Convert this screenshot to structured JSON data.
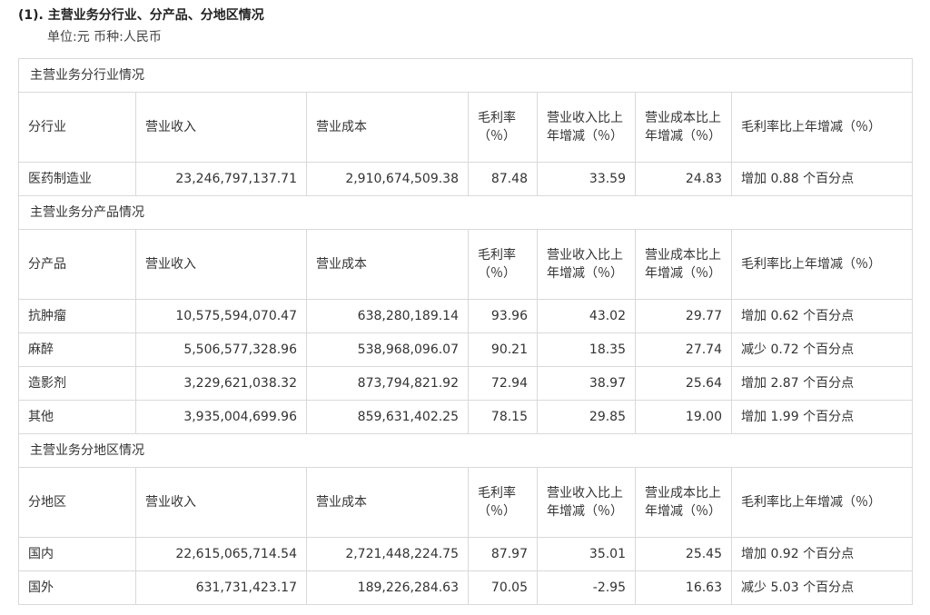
{
  "heading": "(1). 主营业务分行业、分产品、分地区情况",
  "unit": "单位:元 币种:人民币",
  "columns": {
    "revenue": "营业收入",
    "cost": "营业成本",
    "margin": "毛利率（％）",
    "revenue_change": "营业收入比上年增减（％）",
    "cost_change": "营业成本比上年增减（％）",
    "margin_change": "毛利率比上年增减（％）"
  },
  "sections": [
    {
      "title": "主营业务分行业情况",
      "dimension": "分行业",
      "rows": [
        {
          "name": "医药制造业",
          "revenue": "23,246,797,137.71",
          "cost": "2,910,674,509.38",
          "margin": "87.48",
          "revenue_change": "33.59",
          "cost_change": "24.83",
          "margin_change": "增加 0.88 个百分点"
        }
      ]
    },
    {
      "title": "主营业务分产品情况",
      "dimension": "分产品",
      "rows": [
        {
          "name": "抗肿瘤",
          "revenue": "10,575,594,070.47",
          "cost": "638,280,189.14",
          "margin": "93.96",
          "revenue_change": "43.02",
          "cost_change": "29.77",
          "margin_change": "增加 0.62 个百分点"
        },
        {
          "name": "麻醉",
          "revenue": "5,506,577,328.96",
          "cost": "538,968,096.07",
          "margin": "90.21",
          "revenue_change": "18.35",
          "cost_change": "27.74",
          "margin_change": "减少 0.72 个百分点"
        },
        {
          "name": "造影剂",
          "revenue": "3,229,621,038.32",
          "cost": "873,794,821.92",
          "margin": "72.94",
          "revenue_change": "38.97",
          "cost_change": "25.64",
          "margin_change": "增加 2.87 个百分点"
        },
        {
          "name": "其他",
          "revenue": "3,935,004,699.96",
          "cost": "859,631,402.25",
          "margin": "78.15",
          "revenue_change": "29.85",
          "cost_change": "19.00",
          "margin_change": "增加 1.99 个百分点"
        }
      ]
    },
    {
      "title": "主营业务分地区情况",
      "dimension": "分地区",
      "rows": [
        {
          "name": "国内",
          "revenue": "22,615,065,714.54",
          "cost": "2,721,448,224.75",
          "margin": "87.97",
          "revenue_change": "35.01",
          "cost_change": "25.45",
          "margin_change": "增加 0.92 个百分点"
        },
        {
          "name": "国外",
          "revenue": "631,731,423.17",
          "cost": "189,226,284.63",
          "margin": "70.05",
          "revenue_change": "-2.95",
          "cost_change": "16.63",
          "margin_change": "减少 5.03 个百分点"
        }
      ]
    }
  ]
}
